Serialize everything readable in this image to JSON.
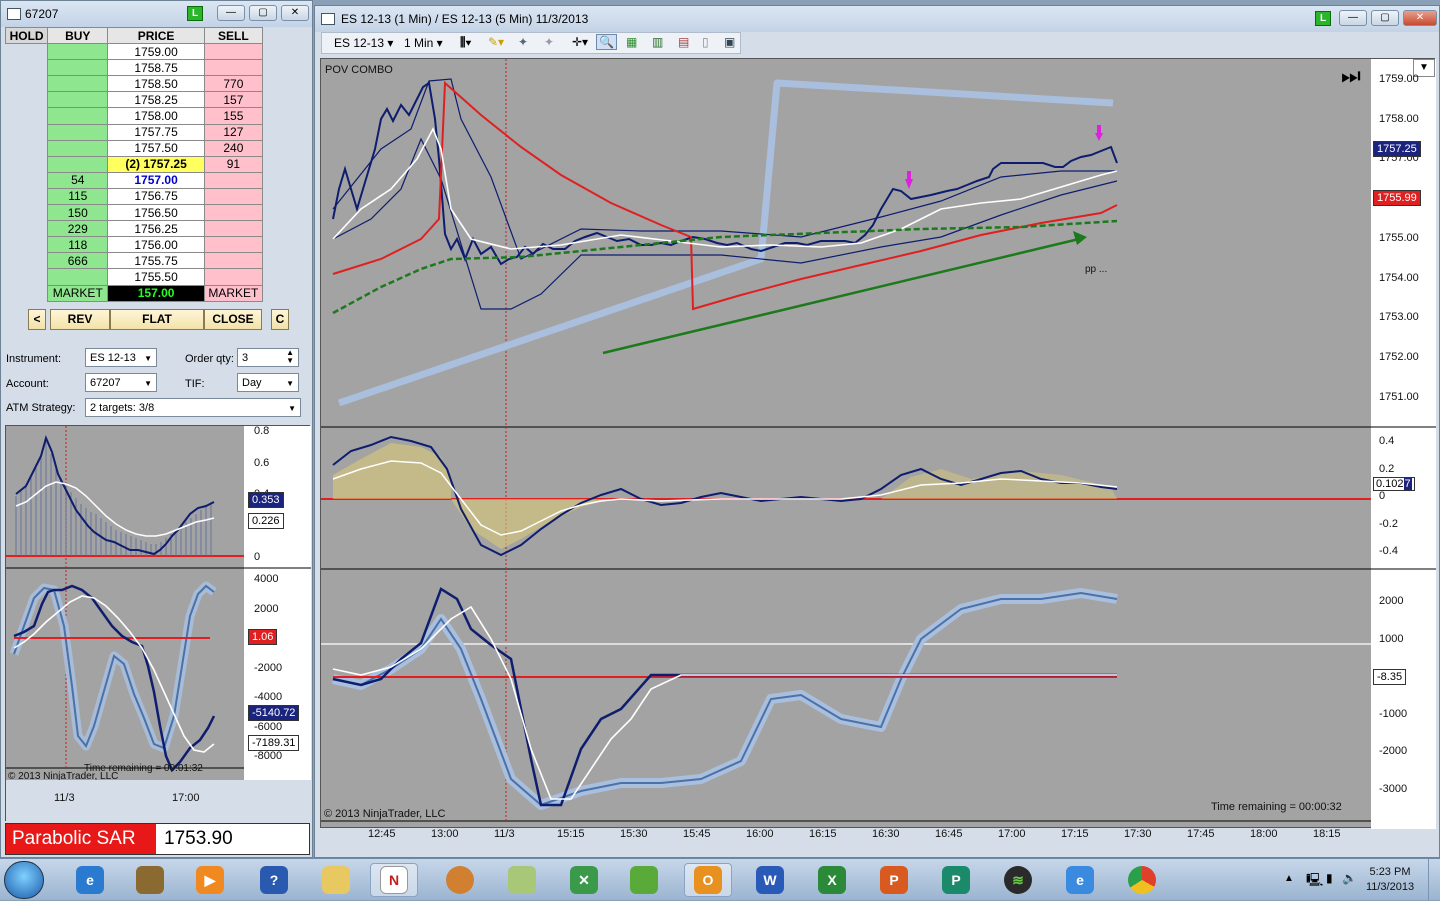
{
  "dom_window": {
    "title": "67207",
    "badge": "L",
    "headers": {
      "hold": "HOLD",
      "buy": "BUY",
      "price": "PRICE",
      "sell": "SELL"
    },
    "rows": [
      {
        "buy": "",
        "price": "1759.00",
        "sell": ""
      },
      {
        "buy": "",
        "price": "1758.75",
        "sell": ""
      },
      {
        "buy": "",
        "price": "1758.50",
        "sell": "770"
      },
      {
        "buy": "",
        "price": "1758.25",
        "sell": "157"
      },
      {
        "buy": "",
        "price": "1758.00",
        "sell": "155"
      },
      {
        "buy": "",
        "price": "1757.75",
        "sell": "127"
      },
      {
        "buy": "",
        "price": "1757.50",
        "sell": "240"
      },
      {
        "buy": "",
        "price": "(2) 1757.25",
        "sell": "91"
      },
      {
        "buy": "54",
        "price": "1757.00",
        "sell": ""
      },
      {
        "buy": "115",
        "price": "1756.75",
        "sell": ""
      },
      {
        "buy": "150",
        "price": "1756.50",
        "sell": ""
      },
      {
        "buy": "229",
        "price": "1756.25",
        "sell": ""
      },
      {
        "buy": "118",
        "price": "1756.00",
        "sell": ""
      },
      {
        "buy": "666",
        "price": "1755.75",
        "sell": ""
      },
      {
        "buy": "",
        "price": "1755.50",
        "sell": ""
      }
    ],
    "market": {
      "buy": "MARKET",
      "value": "157.00",
      "sell": "MARKET"
    },
    "buttons": {
      "left": "<",
      "rev": "REV",
      "flat": "FLAT",
      "close": "CLOSE",
      "c": "C"
    },
    "form": {
      "instrument_label": "Instrument:",
      "instrument": "ES 12-13",
      "order_qty_label": "Order qty:",
      "order_qty": "3",
      "account_label": "Account:",
      "account": "67207",
      "tif_label": "TIF:",
      "tif": "Day",
      "atm_label": "ATM Strategy:",
      "atm": "2 targets: 3/8"
    },
    "mini_chart": {
      "upper_axis": [
        "0.8",
        "0.6",
        "0.4",
        "0.2",
        "0"
      ],
      "upper_tags": [
        "0.353",
        "0.226"
      ],
      "lower_axis": [
        "4000",
        "2000",
        "0",
        "-2000",
        "-4000",
        "-6000",
        "-8000"
      ],
      "lower_tags": [
        "1.06",
        "-5140.72",
        "-7189.31"
      ],
      "copyright": "© 2013 NinjaTrader, LLC",
      "time_remaining": "Time remaining = 00:01:32",
      "x_labels": [
        "11/3",
        "17:00"
      ]
    },
    "parabolic": {
      "label": "Parabolic SAR",
      "value": "1753.90"
    }
  },
  "chart_window": {
    "title": "ES 12-13 (1 Min) / ES 12-13 (5 Min)  11/3/2013",
    "badge": "L",
    "toolbar": {
      "instrument": "ES 12-13",
      "interval": "1 Min"
    },
    "indicator_label": "POV COMBO",
    "pp_label": "pp ...",
    "price_axis": [
      "1759.00",
      "1758.00",
      "1757.00",
      "1756.00",
      "1755.00",
      "1754.00",
      "1753.00",
      "1752.00",
      "1751.00"
    ],
    "price_tags": [
      "1757.25",
      "1755.99"
    ],
    "macd_axis": [
      "0.4",
      "0.2",
      "0",
      "-0.2",
      "-0.4"
    ],
    "macd_tag": "0.102",
    "macd_tag_suffix": "7",
    "osc_axis": [
      "2000",
      "1000",
      "0",
      "-1000",
      "-2000",
      "-3000"
    ],
    "osc_tag": "-8.35",
    "copyright": "© 2013 NinjaTrader, LLC",
    "time_remaining": "Time remaining = 00:00:32",
    "x_labels": [
      "12:45",
      "13:00",
      "11/3",
      "15:15",
      "15:30",
      "15:45",
      "16:00",
      "16:15",
      "16:30",
      "16:45",
      "17:00",
      "17:15",
      "17:30",
      "17:45",
      "18:00",
      "18:15"
    ]
  },
  "taskbar": {
    "clock_time": "5:23 PM",
    "clock_date": "11/3/2013"
  }
}
